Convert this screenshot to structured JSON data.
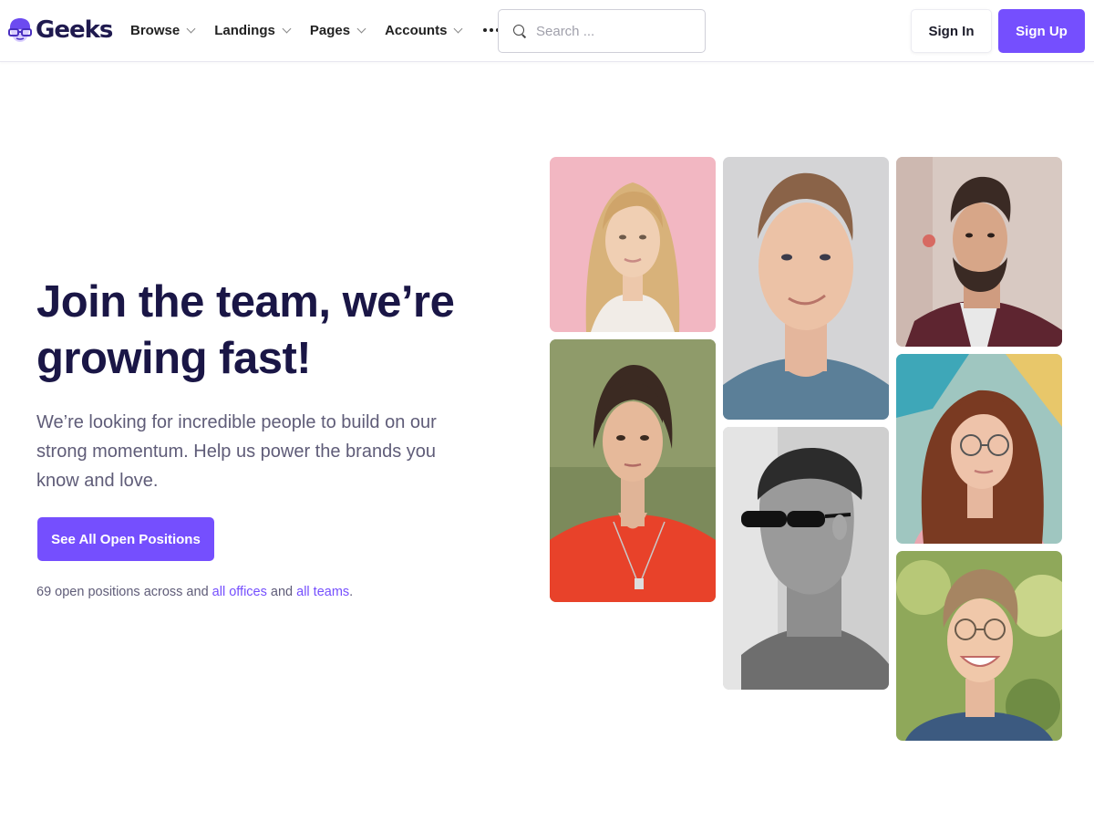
{
  "brand": {
    "name": "Geeks",
    "logo_icon": "geek-face-logo-icon",
    "accent_color": "#754ffe",
    "heading_color": "#1a1646"
  },
  "nav": {
    "items": [
      {
        "label": "Browse"
      },
      {
        "label": "Landings"
      },
      {
        "label": "Pages"
      },
      {
        "label": "Accounts"
      }
    ],
    "more_icon": "more-dots-icon"
  },
  "search": {
    "placeholder": "Search ...",
    "value": "",
    "icon": "search-icon"
  },
  "auth": {
    "sign_in_label": "Sign In",
    "sign_up_label": "Sign Up"
  },
  "hero": {
    "title": "Join the team, we’re growing fast!",
    "description": "We’re looking for incredible people to build on our strong momentum. Help us power the brands you know and love.",
    "cta_label": "See All Open Positions",
    "note_prefix": "69 open positions across and",
    "note_link_offices": "all offices",
    "note_middle": "and",
    "note_link_teams": "all teams",
    "note_suffix": "."
  },
  "photos": [
    {
      "name": "team-photo-blonde-woman"
    },
    {
      "name": "team-photo-woman-red-top"
    },
    {
      "name": "team-photo-smiling-man"
    },
    {
      "name": "team-photo-man-sunglasses"
    },
    {
      "name": "team-photo-bearded-man"
    },
    {
      "name": "team-photo-woman-glasses"
    },
    {
      "name": "team-photo-young-man-glasses"
    }
  ]
}
